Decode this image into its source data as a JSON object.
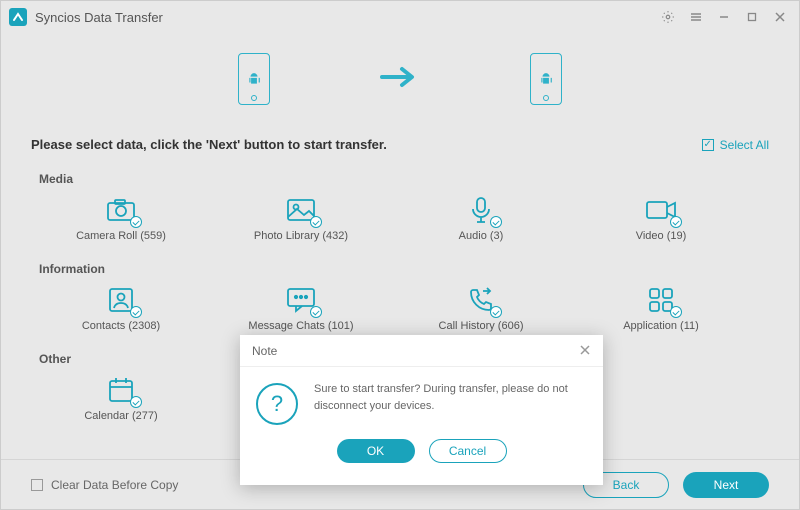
{
  "app": {
    "title": "Syncios Data Transfer"
  },
  "instruction": "Please select data, click the 'Next' button to start transfer.",
  "select_all_label": "Select All",
  "sections": {
    "media": {
      "label": "Media",
      "items": {
        "camera_roll": "Camera Roll (559)",
        "photo_library": "Photo Library (432)",
        "audio": "Audio (3)",
        "video": "Video (19)"
      }
    },
    "information": {
      "label": "Information",
      "items": {
        "contacts": "Contacts (2308)",
        "message_chats": "Message Chats (101)",
        "call_history": "Call History (606)",
        "application": "Application (11)"
      }
    },
    "other": {
      "label": "Other",
      "items": {
        "calendar": "Calendar (277)"
      }
    }
  },
  "footer": {
    "clear_data": "Clear Data Before Copy",
    "back": "Back",
    "next": "Next"
  },
  "modal": {
    "title": "Note",
    "message": "Sure to start transfer? During transfer, please do not disconnect your devices.",
    "ok": "OK",
    "cancel": "Cancel"
  },
  "colors": {
    "accent": "#1aa3bb"
  }
}
